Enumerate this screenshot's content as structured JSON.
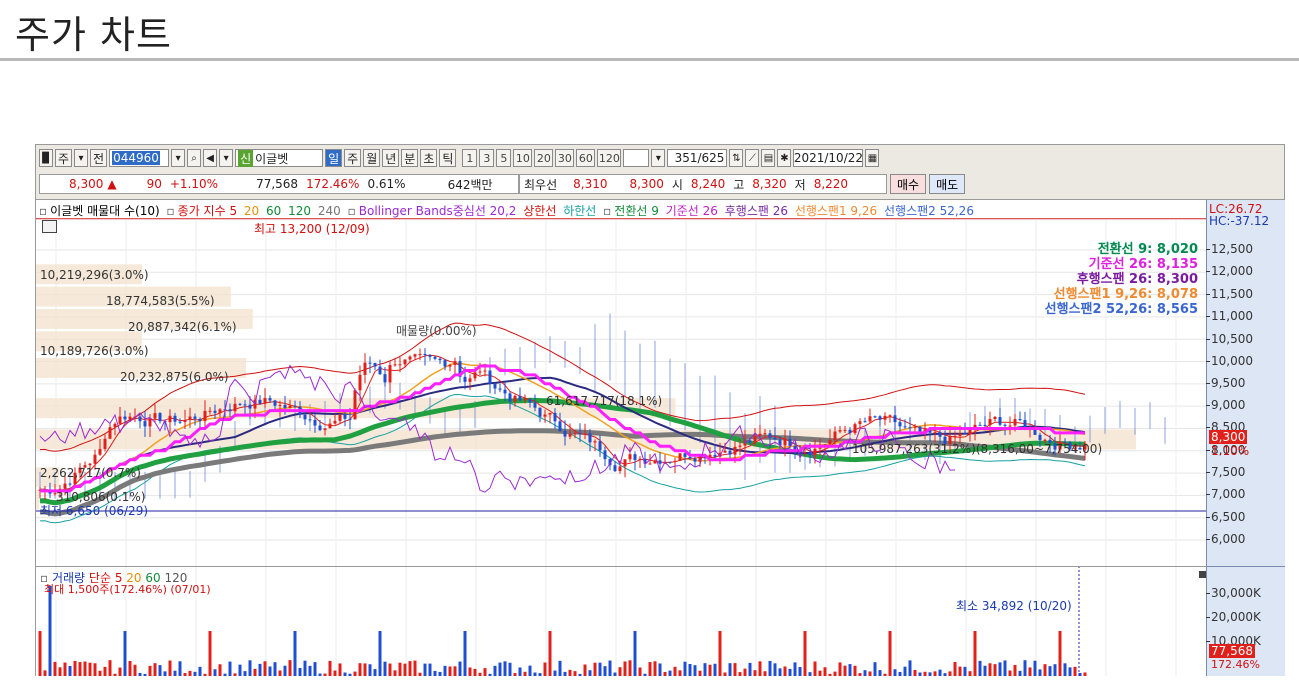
{
  "page": {
    "title": "주가 차트"
  },
  "toolbar": {
    "btn_window": "▉",
    "btn_ju": "주",
    "btn_ju_drop": "▾",
    "btn_jeon": "전",
    "code": "044960",
    "code_drop": "▾",
    "search_icon": "⌕",
    "speaker_icon": "◀",
    "speaker_drop": "▾",
    "name_badge": "신",
    "name": "이글벳",
    "periods": [
      "일",
      "주",
      "월",
      "년",
      "분",
      "초",
      "틱"
    ],
    "selected_period": "일",
    "intervals": [
      "1",
      "3",
      "5",
      "10",
      "20",
      "30",
      "60",
      "120"
    ],
    "count_current": "351",
    "count_total": "/625",
    "date": "2021/10/22",
    "icons": [
      "bar-settings-icon",
      "line-tool-icon",
      "save-icon",
      "gear-icon",
      "calendar-icon"
    ]
  },
  "quote": {
    "price": "8,300",
    "change_arrow": "▲",
    "change": "90",
    "change_pct": "+1.10%",
    "volume": "77,568",
    "volume_pct": "172.46%",
    "turnover": "0.61%",
    "amount": "642백만",
    "best_label": "최우선",
    "best_ask": "8,310",
    "best_bid": "8,300",
    "open_label": "시",
    "open": "8,240",
    "high_label": "고",
    "high": "8,320",
    "low_label": "저",
    "low": "8,220",
    "buy_label": "매수",
    "sell_label": "매도"
  },
  "legend": {
    "item1": "이글벳 매물대 수(10)",
    "item2": "종가 지수 5",
    "item2_20": "20",
    "item2_60": "60",
    "item2_120": "120",
    "item2_240": "240",
    "item3": "Bollinger Bands중심선 20,2",
    "item3_upper": "상한선",
    "item3_lower": "하한선",
    "item4": "전환선 9",
    "item4_base": "기준선 26",
    "item4_lag": "후행스팬 26",
    "item4_lead1": "선행스팬1 9,26",
    "item4_lead2": "선행스팬2 52,26"
  },
  "axis": {
    "lc": "LC:26.72",
    "hc": "HC:-37.12",
    "ticks": [
      "12,500",
      "12,000",
      "11,500",
      "11,000",
      "10,500",
      "10,000",
      "9,500",
      "9,000",
      "8,500",
      "8,000",
      "7,500",
      "7,000",
      "6,500",
      "6,000"
    ],
    "price_tag": "8,300",
    "pct_tag": "1.10%"
  },
  "ichimoku": {
    "conv": "전환선 9: 8,020",
    "base": "기준선 26: 8,135",
    "lag": "후행스팬 26: 8,300",
    "lead1": "선행스팬1 9,26: 8,078",
    "lead2": "선행스팬2 52,26: 8,565"
  },
  "annotations": {
    "high": "최고 13,200 (12/09)",
    "low": "최저 6,650 (06/29)",
    "vp1": "10,219,296(3.0%)",
    "vp2": "18,774,583(5.5%)",
    "vp3": "20,887,342(6.1%)",
    "vp4": "10,189,726(3.0%)",
    "vp5": "20,232,875(6.0%)",
    "vp6": "61,617,717(18.1%)",
    "vp7": "105,987,263(31.2%)(8,316,00~7,754.00)",
    "vp8": "2,262,717(0.7%)",
    "vp9": "310,806(0.1%)",
    "vol_legend": "매물량(0.00%)"
  },
  "volume": {
    "legend_title": "거래량",
    "legend_ma": "단순 5",
    "legend_20": "20",
    "legend_60": "60",
    "legend_120": "120",
    "max_label": "최대 1,500주(172.46%) (07/01)",
    "min_label": "최소 34,892 (10/20)",
    "ticks": [
      "30,000K",
      "20,000K",
      "10,000K"
    ],
    "vol_tag": "77,568",
    "vol_pct_tag": "172.46%"
  },
  "colors": {
    "up": "#e0201a",
    "down": "#1f4fd0",
    "ma5": "#e0201a",
    "ma20": "#f0a020",
    "ma60": "#20a040",
    "ma120": "#2a2a80",
    "ma240": "#808080",
    "base_line": "#ff20ff",
    "conv_line": "#00a060",
    "cloud": "#4466cc"
  }
}
